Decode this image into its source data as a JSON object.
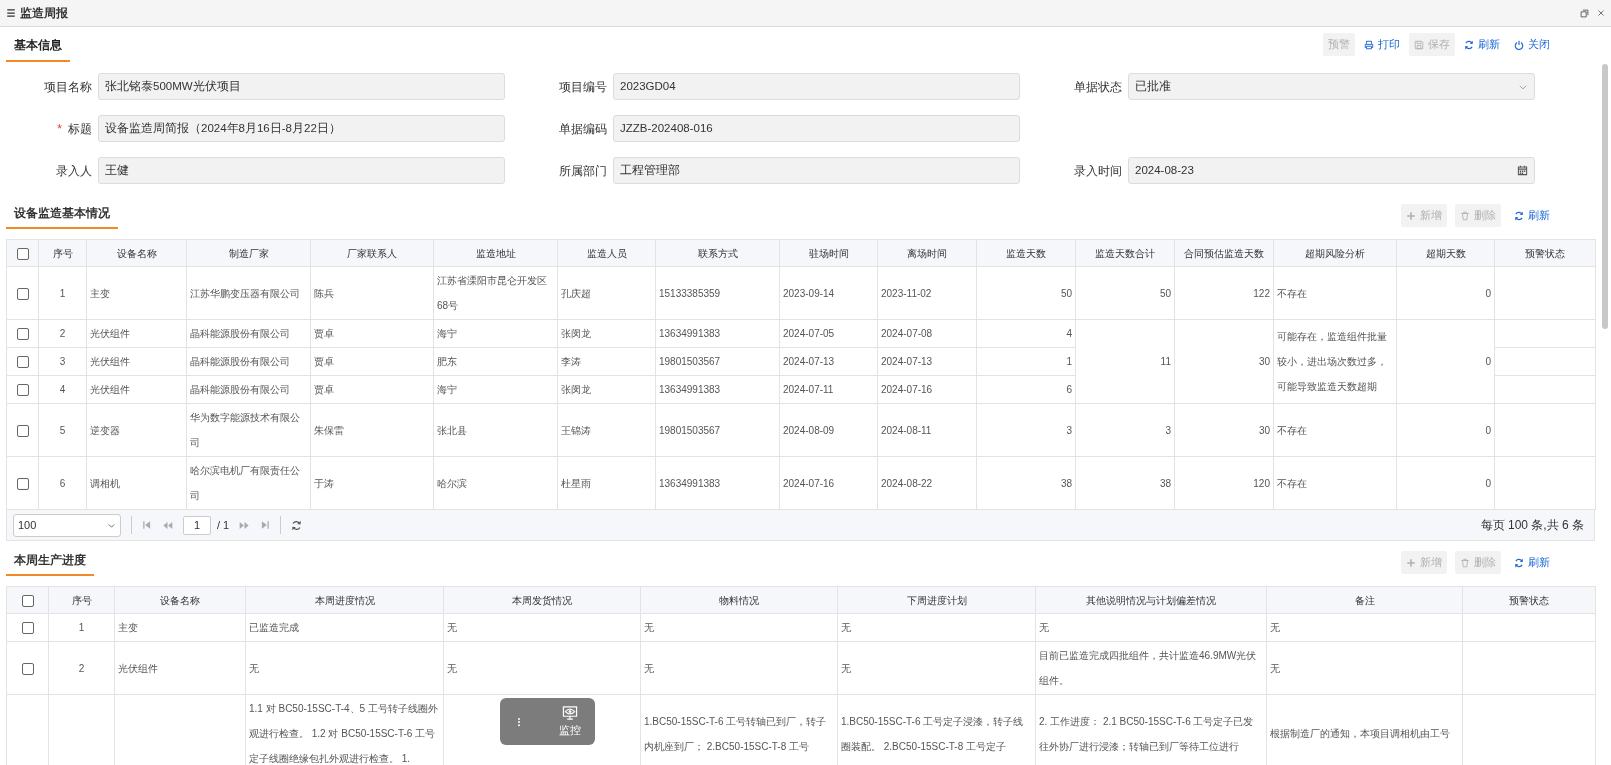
{
  "window": {
    "title": "监造周报"
  },
  "tabs": [
    {
      "label": "基本信息",
      "selected": true
    }
  ],
  "toolbar": [
    {
      "kind": "warn",
      "label": "预警",
      "disabled": true
    },
    {
      "kind": "print",
      "label": "打印",
      "disabled": false
    },
    {
      "kind": "save",
      "label": "保存",
      "disabled": true
    },
    {
      "kind": "refresh",
      "label": "刷新",
      "disabled": false
    },
    {
      "kind": "close",
      "label": "关闭",
      "disabled": false
    }
  ],
  "form": {
    "rows": [
      [
        {
          "label": "项目名称",
          "value": "张北铭泰500MW光伏项目",
          "kind": "text"
        },
        {
          "label": "项目编号",
          "value": "2023GD04",
          "kind": "text"
        },
        {
          "label": "单据状态",
          "value": "已批准",
          "kind": "select"
        }
      ],
      [
        {
          "label": "标题",
          "marker": "*",
          "value": "设备监造周简报（2024年8月16日-8月22日）",
          "kind": "text"
        },
        {
          "label": "单据编码",
          "value": "JZZB-202408-016",
          "kind": "text"
        }
      ],
      [
        {
          "label": "录入人",
          "value": "王健",
          "kind": "text"
        },
        {
          "label": "所属部门",
          "value": "工程管理部",
          "kind": "text"
        },
        {
          "label": "录入时间",
          "value": "2024-08-23",
          "kind": "date"
        }
      ]
    ]
  },
  "sections": [
    {
      "title": "设备监造基本情况",
      "actions": [
        {
          "kind": "add",
          "label": "新增",
          "disabled": true
        },
        {
          "kind": "delete",
          "label": "删除",
          "disabled": true
        },
        {
          "kind": "refresh",
          "label": "刷新",
          "disabled": false
        }
      ],
      "table": {
        "all_checked": false,
        "columns": [
          {
            "label": "序号",
            "kind": "index"
          },
          {
            "label": "设备名称",
            "kind": "text"
          },
          {
            "label": "制造厂家",
            "kind": "text"
          },
          {
            "label": "厂家联系人",
            "kind": "text"
          },
          {
            "label": "监造地址",
            "kind": "text"
          },
          {
            "label": "监造人员",
            "kind": "text"
          },
          {
            "label": "联系方式",
            "kind": "text"
          },
          {
            "label": "驻场时间",
            "kind": "text"
          },
          {
            "label": "离场时间",
            "kind": "text"
          },
          {
            "label": "监造天数",
            "kind": "number"
          },
          {
            "label": "监造天数合计",
            "kind": "number"
          },
          {
            "label": "合同预估监造天数",
            "kind": "number"
          },
          {
            "label": "超期风险分析",
            "kind": "text"
          },
          {
            "label": "超期天数",
            "kind": "number"
          },
          {
            "label": "预警状态",
            "kind": "text"
          }
        ],
        "rows": [
          {
            "checked": false,
            "cells": [
              "1",
              "主变",
              "江苏华鹏变压器有限公司",
              "陈兵",
              "江苏省溧阳市昆仑开发区68号",
              "孔庆超",
              "15133385359",
              "2023-09-14",
              "2023-11-02",
              "50",
              "50",
              "122",
              "不存在",
              "0"
            ]
          },
          {
            "checked": false,
            "cells": [
              "2",
              "光伏组件",
              "晶科能源股份有限公司",
              "贾卓",
              "海宁",
              "张闵龙",
              "13634991383",
              "2024-07-05",
              "2024-07-08",
              "4",
              {
                "text": "11",
                "rowspan": 3
              },
              {
                "text": "30",
                "rowspan": 3
              },
              {
                "text": "可能存在，监造组件批量较小，进出场次数过多，可能导致监造天数超期",
                "rowspan": 3
              },
              {
                "text": "0",
                "rowspan": 3
              }
            ]
          },
          {
            "checked": false,
            "cells": [
              "3",
              "光伏组件",
              "晶科能源股份有限公司",
              "贾卓",
              "肥东",
              "李涛",
              "19801503567",
              "2024-07-13",
              "2024-07-13",
              "1"
            ]
          },
          {
            "checked": false,
            "cells": [
              "4",
              "光伏组件",
              "晶科能源股份有限公司",
              "贾卓",
              "海宁",
              "张闵龙",
              "13634991383",
              "2024-07-11",
              "2024-07-16",
              "6"
            ]
          },
          {
            "checked": false,
            "cells": [
              "5",
              "逆变器",
              "华为数字能源技术有限公司",
              "朱保雷",
              "张北县",
              "王锦涛",
              "19801503567",
              "2024-08-09",
              "2024-08-11",
              "3",
              "3",
              "30",
              "不存在",
              "0"
            ]
          },
          {
            "checked": false,
            "cells": [
              "6",
              "调相机",
              "哈尔滨电机厂有限责任公司",
              "于涛",
              "哈尔滨",
              "杜星雨",
              "13634991383",
              "2024-07-16",
              "2024-08-22",
              "38",
              "38",
              "120",
              "不存在",
              "0"
            ]
          }
        ]
      },
      "pager": {
        "page_size": "100",
        "page": "1",
        "page_total": "/ 1",
        "summary": "每页 100 条,共 6 条"
      }
    },
    {
      "title": "本周生产进度",
      "actions": [
        {
          "kind": "add",
          "label": "新增",
          "disabled": true
        },
        {
          "kind": "delete",
          "label": "删除",
          "disabled": true
        },
        {
          "kind": "refresh",
          "label": "刷新",
          "disabled": false
        }
      ],
      "table": {
        "all_checked": false,
        "columns": [
          {
            "label": "序号",
            "kind": "index"
          },
          {
            "label": "设备名称",
            "kind": "text"
          },
          {
            "label": "本周进度情况",
            "kind": "text"
          },
          {
            "label": "本周发货情况",
            "kind": "text"
          },
          {
            "label": "物料情况",
            "kind": "text"
          },
          {
            "label": "下周进度计划",
            "kind": "text"
          },
          {
            "label": "其他说明情况与计划偏差情况",
            "kind": "text"
          },
          {
            "label": "备注",
            "kind": "text"
          },
          {
            "label": "预警状态",
            "kind": "text"
          }
        ],
        "rows": [
          {
            "checked": false,
            "cells": [
              "1",
              "主变",
              "已监造完成",
              "无",
              "无",
              "无",
              "无",
              "无"
            ]
          },
          {
            "checked": false,
            "cells": [
              "2",
              "光伏组件",
              "无",
              "无",
              "无",
              "无",
              "目前已监造完成四批组件，共计监造46.9MW光伏组件。",
              "无"
            ]
          },
          {
            "cells": [
              null,
              null,
              "1.1 对 BC50-15SC-T-4、5 工号转子线圈外观进行检查。 1.2 对 BC50-15SC-T-6 工号定子线圈绝缘包扎外观进行检查。 1.",
              null,
              "1.BC50-15SC-T-6 工号转轴已到厂，转子内机座到厂； 2.BC50-15SC-T-8 工号",
              "1.BC50-15SC-T-6 工号定子浸漆，转子线圈装配。 2.BC50-15SC-T-8 工号定子",
              "2. 工作进度： 2.1 BC50-15SC-T-6 工号定子已发往外协厂进行浸漆；转轴已到厂等待工位进行",
              "根据制造厂的通知，本项目调相机由工号"
            ]
          }
        ]
      }
    }
  ],
  "floating_widget": {
    "label": "监控"
  }
}
